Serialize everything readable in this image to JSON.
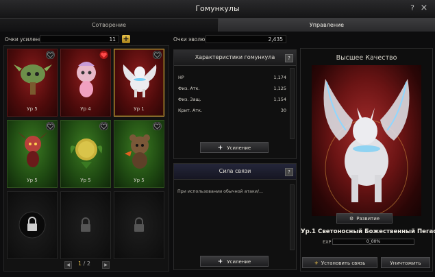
{
  "window": {
    "title": "Гомункулы",
    "help": "?",
    "close": "×"
  },
  "tabs": [
    {
      "label": "Сотворение"
    },
    {
      "label": "Управление"
    }
  ],
  "points": {
    "enhance_label": "Очки усиления",
    "enhance_value": "11",
    "evolution_label": "Очки эволюции",
    "evolution_value": "2,435"
  },
  "slots": [
    {
      "level": "Ур 5",
      "bg": "red",
      "heart": "empty",
      "creature": "treant"
    },
    {
      "level": "Ур 4",
      "bg": "red",
      "heart": "filled",
      "creature": "fairy"
    },
    {
      "level": "Ур 1",
      "bg": "red",
      "heart": "empty",
      "creature": "pegasus",
      "selected": true
    },
    {
      "level": "Ур 5",
      "bg": "green",
      "heart": "empty",
      "creature": "imp"
    },
    {
      "level": "Ур 5",
      "bg": "green",
      "heart": "empty",
      "creature": "seed"
    },
    {
      "level": "Ур 5",
      "bg": "green",
      "heart": "empty",
      "creature": "bear"
    },
    {
      "level": "",
      "bg": "locked",
      "lock_style": "round"
    },
    {
      "level": "",
      "bg": "locked",
      "lock_style": "plain"
    },
    {
      "level": "",
      "bg": "locked",
      "lock_style": "plain"
    }
  ],
  "pager": {
    "current": "1",
    "sep": "/",
    "total": "2"
  },
  "stats_panel": {
    "title": "Характеристики гомункула",
    "rows": [
      {
        "label": "HP",
        "value": "1,174"
      },
      {
        "label": "Физ. Атк.",
        "value": "1,125"
      },
      {
        "label": "Физ. Защ.",
        "value": "1,154"
      },
      {
        "label": "Крит. Атк.",
        "value": "30"
      }
    ],
    "button": "Усиление"
  },
  "bond_panel": {
    "title": "Сила связи",
    "text": "При использовании обычной атаки/...",
    "button": "Усиление"
  },
  "detail": {
    "quality": "Высшее Качество",
    "evolve_button": "Развитие",
    "name": "Ур.1 Светоносный Божественный Пегас",
    "exp_label": "EXP",
    "exp_value": "0_00%",
    "exp_fraction": 0.0,
    "bind_button": "Установить связь",
    "destroy_button": "Уничтожить"
  }
}
